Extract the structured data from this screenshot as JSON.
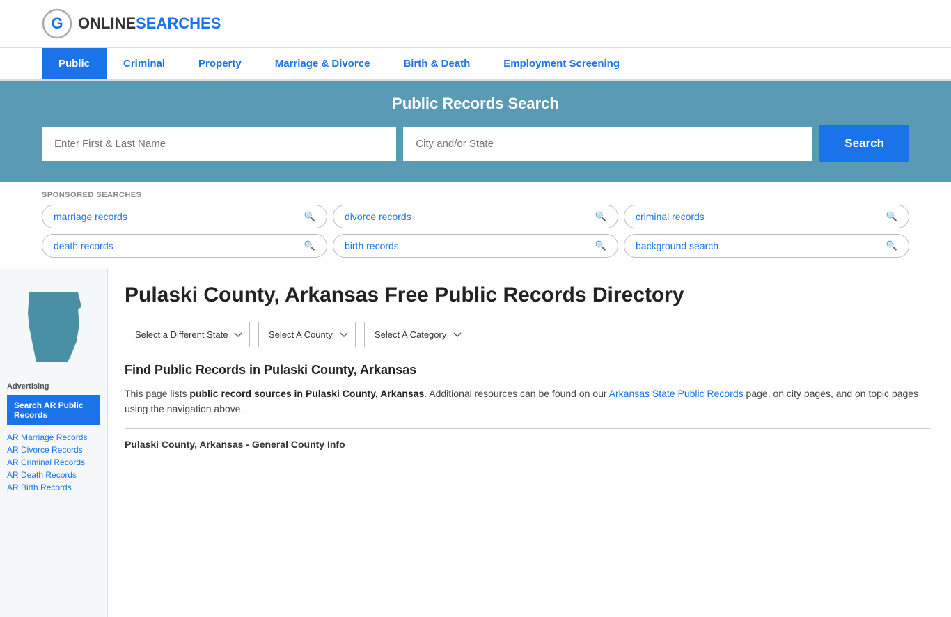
{
  "site": {
    "logo_online": "ONLINE",
    "logo_searches": "SEARCHES"
  },
  "nav": {
    "items": [
      {
        "label": "Public",
        "active": true
      },
      {
        "label": "Criminal",
        "active": false
      },
      {
        "label": "Property",
        "active": false
      },
      {
        "label": "Marriage & Divorce",
        "active": false
      },
      {
        "label": "Birth & Death",
        "active": false
      },
      {
        "label": "Employment Screening",
        "active": false
      }
    ]
  },
  "hero": {
    "title": "Public Records Search",
    "name_placeholder": "Enter First & Last Name",
    "location_placeholder": "City and/or State",
    "search_label": "Search"
  },
  "sponsored": {
    "label": "SPONSORED SEARCHES",
    "items": [
      "marriage records",
      "divorce records",
      "criminal records",
      "death records",
      "birth records",
      "background search"
    ]
  },
  "page": {
    "title": "Pulaski County, Arkansas Free Public Records Directory",
    "dropdown_state": "Select a Different State",
    "dropdown_county": "Select A County",
    "dropdown_category": "Select A Category",
    "find_records_title": "Find Public Records in Pulaski County, Arkansas",
    "description": "This page lists ",
    "description_bold": "public record sources in Pulaski County, Arkansas",
    "description_end": ". Additional resources can be found on our ",
    "description_link": "Arkansas State Public Records",
    "description_rest": " page, on city pages, and on topic pages using the navigation above.",
    "county_info_title": "Pulaski County, Arkansas - General County Info"
  },
  "sidebar": {
    "advertising_label": "Advertising",
    "ad_box_text": "Search AR Public Records",
    "links": [
      "AR Marriage Records",
      "AR Divorce Records",
      "AR Criminal Records",
      "AR Death Records",
      "AR Birth Records"
    ]
  }
}
